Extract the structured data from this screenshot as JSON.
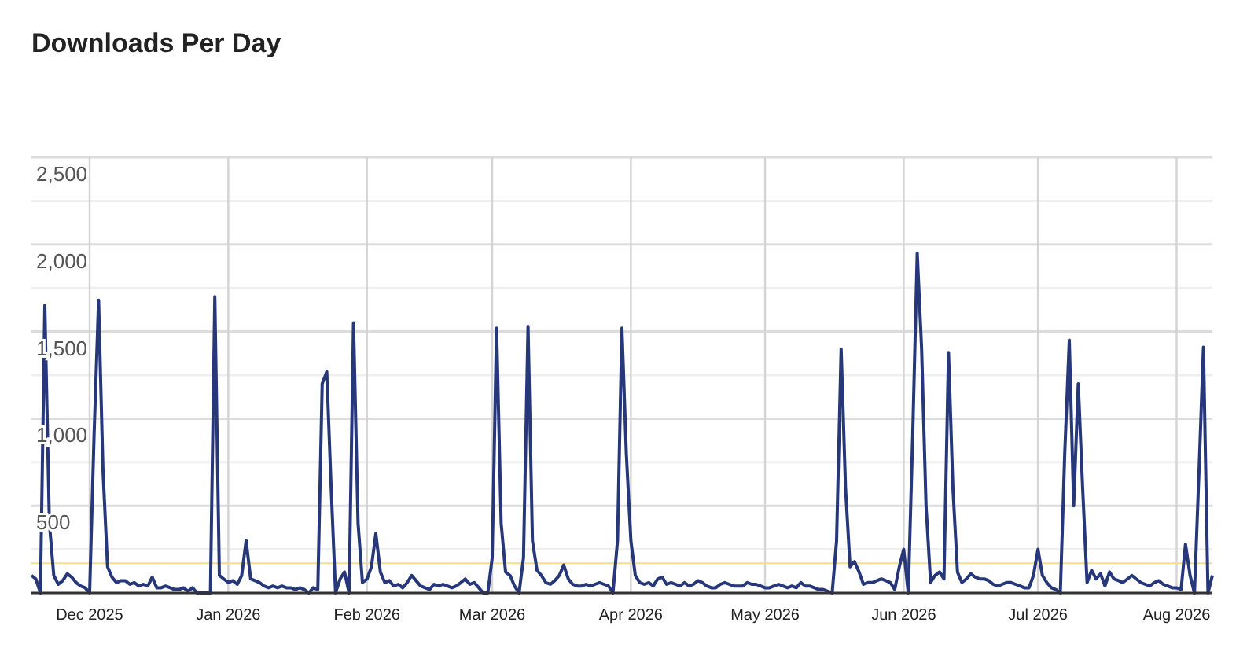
{
  "title": "Downloads Per Day",
  "chart_data": {
    "type": "line",
    "categories": [
      null,
      null,
      null,
      null,
      null,
      null,
      null,
      null,
      null,
      null,
      null,
      null,
      null,
      "Dec 2025",
      null,
      null,
      null,
      null,
      null,
      null,
      null,
      null,
      null,
      null,
      null,
      null,
      null,
      null,
      null,
      null,
      null,
      null,
      null,
      null,
      null,
      null,
      null,
      null,
      null,
      null,
      null,
      null,
      null,
      null,
      "Jan 2026",
      null,
      null,
      null,
      null,
      null,
      null,
      null,
      null,
      null,
      null,
      null,
      null,
      null,
      null,
      null,
      null,
      null,
      null,
      null,
      null,
      null,
      null,
      null,
      null,
      null,
      null,
      null,
      null,
      null,
      null,
      "Feb 2026",
      null,
      null,
      null,
      null,
      null,
      null,
      null,
      null,
      null,
      null,
      null,
      null,
      null,
      null,
      null,
      null,
      null,
      null,
      null,
      null,
      null,
      null,
      null,
      null,
      null,
      null,
      null,
      "Mar 2026",
      null,
      null,
      null,
      null,
      null,
      null,
      null,
      null,
      null,
      null,
      null,
      null,
      null,
      null,
      null,
      null,
      null,
      null,
      null,
      null,
      null,
      null,
      null,
      null,
      null,
      null,
      null,
      null,
      null,
      null,
      "Apr 2026",
      null,
      null,
      null,
      null,
      null,
      null,
      null,
      null,
      null,
      null,
      null,
      null,
      null,
      null,
      null,
      null,
      null,
      null,
      null,
      null,
      null,
      null,
      null,
      null,
      null,
      null,
      null,
      null,
      null,
      "May 2026",
      null,
      null,
      null,
      null,
      null,
      null,
      null,
      null,
      null,
      null,
      null,
      null,
      null,
      null,
      null,
      null,
      null,
      null,
      null,
      null,
      null,
      null,
      null,
      null,
      null,
      null,
      null,
      null,
      null,
      null,
      "Jun 2026",
      null,
      null,
      null,
      null,
      null,
      null,
      null,
      null,
      null,
      null,
      null,
      null,
      null,
      null,
      null,
      null,
      null,
      null,
      null,
      null,
      null,
      null,
      null,
      null,
      null,
      null,
      null,
      null,
      null,
      "Jul 2026",
      null,
      null,
      null,
      null,
      null,
      null,
      null,
      null,
      null,
      null,
      null,
      null,
      null,
      null,
      null,
      null,
      null,
      null,
      null,
      null,
      null,
      null,
      null,
      null,
      null,
      null,
      null,
      null,
      null,
      null,
      "Aug 2026",
      null,
      null,
      null,
      null,
      null,
      null,
      null,
      null
    ],
    "series": [
      {
        "color": "#26377a",
        "values": [
          100,
          80,
          0,
          1650,
          400,
          100,
          50,
          70,
          110,
          90,
          60,
          40,
          30,
          0,
          900,
          1680,
          700,
          150,
          90,
          60,
          70,
          70,
          50,
          60,
          40,
          50,
          40,
          90,
          30,
          30,
          40,
          30,
          20,
          20,
          30,
          10,
          30,
          0,
          0,
          0,
          0,
          1700,
          100,
          80,
          60,
          70,
          50,
          100,
          300,
          80,
          70,
          60,
          40,
          30,
          40,
          30,
          40,
          30,
          30,
          20,
          30,
          20,
          0,
          30,
          20,
          1200,
          1270,
          600,
          0,
          80,
          120,
          0,
          1550,
          400,
          60,
          80,
          150,
          340,
          120,
          60,
          70,
          40,
          50,
          30,
          60,
          100,
          70,
          40,
          30,
          20,
          50,
          40,
          50,
          40,
          30,
          40,
          60,
          80,
          50,
          60,
          30,
          0,
          0,
          200,
          1520,
          400,
          120,
          100,
          40,
          0,
          200,
          1530,
          300,
          130,
          100,
          60,
          50,
          70,
          100,
          160,
          80,
          50,
          40,
          40,
          50,
          40,
          50,
          60,
          50,
          40,
          0,
          300,
          1520,
          800,
          300,
          100,
          60,
          50,
          60,
          40,
          80,
          90,
          50,
          60,
          50,
          40,
          60,
          40,
          50,
          70,
          60,
          40,
          30,
          30,
          50,
          60,
          50,
          40,
          40,
          40,
          60,
          50,
          50,
          40,
          30,
          30,
          40,
          50,
          40,
          30,
          40,
          30,
          60,
          40,
          40,
          30,
          20,
          20,
          10,
          0,
          300,
          1400,
          600,
          150,
          180,
          120,
          50,
          60,
          60,
          70,
          80,
          70,
          60,
          20,
          150,
          250,
          0,
          900,
          1950,
          1400,
          500,
          60,
          100,
          120,
          80,
          1380,
          600,
          120,
          60,
          80,
          110,
          90,
          80,
          80,
          70,
          50,
          40,
          50,
          60,
          60,
          50,
          40,
          30,
          30,
          100,
          250,
          100,
          60,
          30,
          20,
          0,
          800,
          1450,
          500,
          1200,
          600,
          60,
          130,
          80,
          110,
          40,
          120,
          80,
          70,
          60,
          80,
          100,
          80,
          60,
          50,
          40,
          60,
          70,
          50,
          40,
          30,
          30,
          20,
          280,
          100,
          0,
          700,
          1410,
          0,
          100
        ]
      }
    ],
    "ylim": [
      0,
      2500
    ],
    "grid": true,
    "yticks": [
      {
        "value": 500,
        "label": "500"
      },
      {
        "value": 1000,
        "label": "1,000"
      },
      {
        "value": 1500,
        "label": "1,500"
      },
      {
        "value": 2000,
        "label": "2,000"
      },
      {
        "value": 2500,
        "label": "2,500"
      }
    ],
    "ref_lines": [
      {
        "axis": "y",
        "value": 170
      }
    ]
  }
}
